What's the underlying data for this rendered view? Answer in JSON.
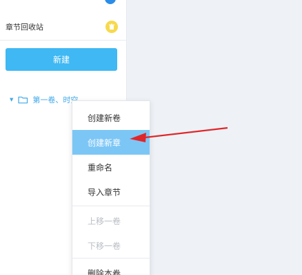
{
  "sidebar": {
    "recycle_label": "章节回收站",
    "new_button_label": "新建",
    "volume_label": "第一卷、时空"
  },
  "context_menu": {
    "items": [
      {
        "label": "创建新卷",
        "state": "normal"
      },
      {
        "label": "创建新章",
        "state": "active"
      },
      {
        "label": "重命名",
        "state": "normal"
      },
      {
        "label": "导入章节",
        "state": "normal"
      },
      {
        "label": "上移一卷",
        "state": "disabled"
      },
      {
        "label": "下移一卷",
        "state": "disabled"
      },
      {
        "label": "删除本卷",
        "state": "normal"
      }
    ]
  },
  "colors": {
    "primary": "#3fb8f3",
    "highlight": "#7cc6f6",
    "link": "#3fa8e8",
    "badge": "#f7d94c",
    "annotation_arrow": "#e0262a"
  }
}
